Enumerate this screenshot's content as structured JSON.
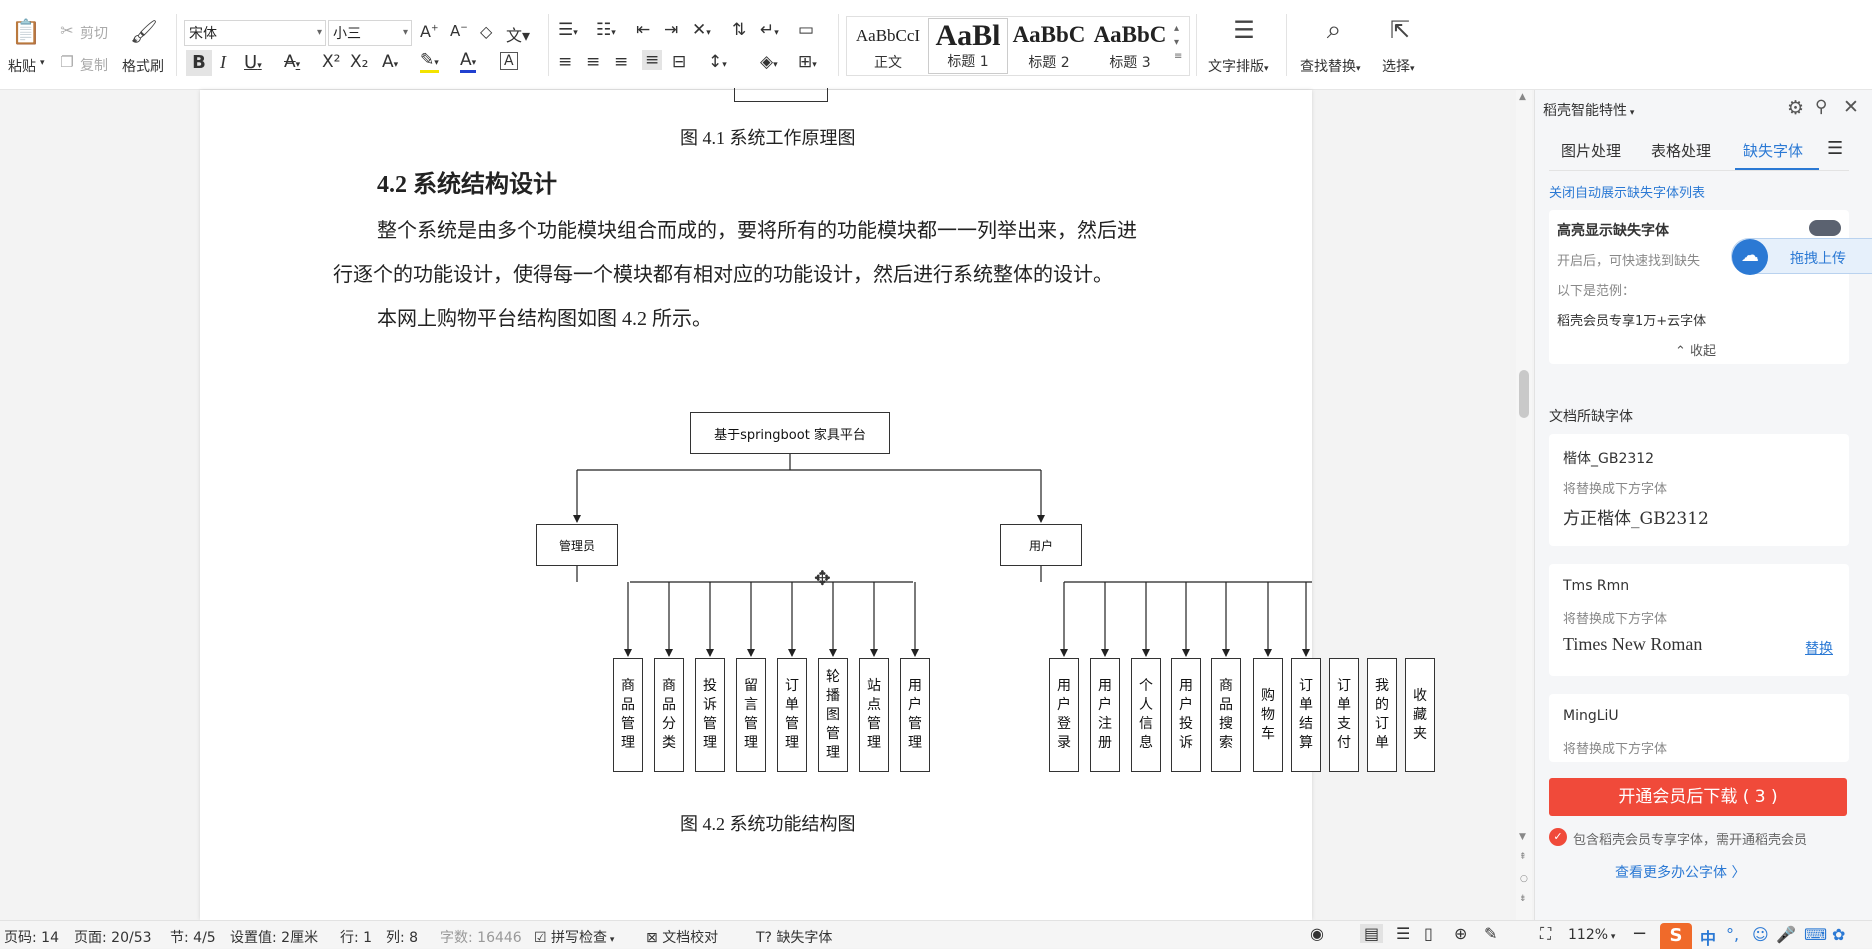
{
  "toolbar": {
    "paste": "粘贴",
    "cut": "剪切",
    "copy": "复制",
    "format_painter": "格式刷",
    "font_name": "宋体",
    "font_size": "小三",
    "styles": [
      {
        "preview": "AaBbCcI",
        "label": "正文"
      },
      {
        "preview": "AaBl",
        "label": "标题 1"
      },
      {
        "preview": "AaBbC",
        "label": "标题 2"
      },
      {
        "preview": "AaBbC",
        "label": "标题 3"
      }
    ],
    "text_layout": "文字排版",
    "find_replace": "查找替换",
    "select": "选择"
  },
  "document": {
    "caption_1": "图 4.1    系统工作原理图",
    "heading": "4.2  系统结构设计",
    "para1_line1": "整个系统是由多个功能模块组合而成的，要将所有的功能模块都一一列举出来，然后进",
    "para1_line2": "行逐个的功能设计，使得每一个模块都有相对应的功能设计，然后进行系统整体的设计。",
    "para2": "本网上购物平台结构图如图 4.2 所示。",
    "caption_2": "图 4.2    系统功能结构图",
    "diagram": {
      "root": "基于springboot 家具平台",
      "admin": "管理员",
      "user": "用户",
      "admin_items": [
        "商品管理",
        "商品分类",
        "投诉管理",
        "留言管理",
        "订单管理",
        "轮播图管理",
        "站点管理",
        "用户管理"
      ],
      "user_items": [
        "用户登录",
        "用户注册",
        "个人信息",
        "用户投诉",
        "商品搜索",
        "购物车",
        "订单结算",
        "订单支付",
        "我的订单",
        "收藏夹"
      ]
    }
  },
  "panel": {
    "title": "稻壳智能特性",
    "tabs": [
      "图片处理",
      "表格处理",
      "缺失字体"
    ],
    "active_tab": 2,
    "close_auto_link": "关闭自动展示缺失字体列表",
    "highlight_title": "高亮显示缺失字体",
    "highlight_desc": "开启后，可快速找到缺失",
    "example_label": "以下是范例：",
    "example_text": "稻壳会员专享1万+云字体",
    "collapse": "收起",
    "drag_upload": "拖拽上传",
    "section_label": "文档所缺字体",
    "fonts": [
      {
        "name": "楷体_GB2312",
        "hint": "将替换成下方字体",
        "replacement": "方正楷体_GB2312",
        "action": ""
      },
      {
        "name": "Tms Rmn",
        "hint": "将替换成下方字体",
        "replacement": "Times New Roman",
        "action": "替换"
      },
      {
        "name": "MingLiU",
        "hint": "将替换成下方字体",
        "replacement": "",
        "action": ""
      }
    ],
    "download_button": "开通会员后下载 ( 3 )",
    "member_note": "包含稻壳会员专享字体，需开通稻壳会员",
    "more_fonts": "查看更多办公字体 〉"
  },
  "statusbar": {
    "page_num": "页码: 14",
    "pages": "页面: 20/53",
    "section": "节: 4/5",
    "setting": "设置值: 2厘米",
    "row": "行: 1",
    "col": "列: 8",
    "word_count": "字数: 16446",
    "spell_check": "拼写检查",
    "proofread": "文档校对",
    "missing_font": "缺失字体",
    "zoom": "112%",
    "ime": "中"
  },
  "colors": {
    "accent": "#2b79d4",
    "download_button": "#f04a3a",
    "ime_logo": "#f06a2a"
  }
}
